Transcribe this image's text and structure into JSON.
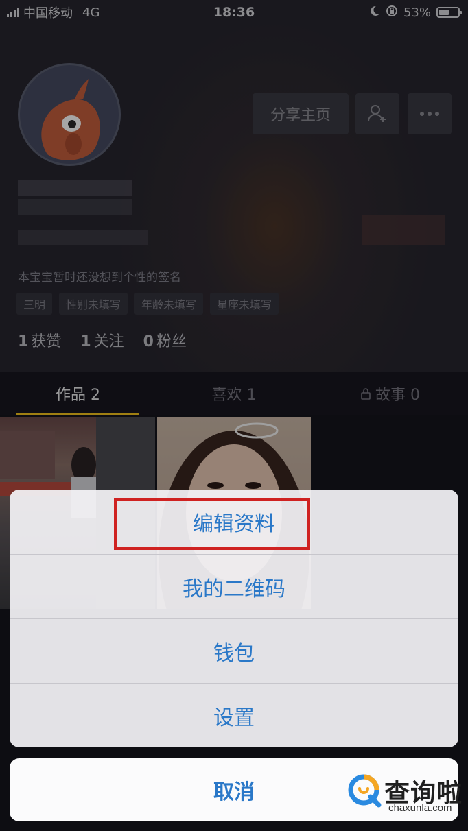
{
  "status_bar": {
    "carrier": "中国移动",
    "network": "4G",
    "time": "18:36",
    "battery": "53%",
    "battery_level": 0.53
  },
  "profile": {
    "share_label": "分享主页",
    "signature": "本宝宝暂时还没想到个性的签名",
    "tags": [
      "三明",
      "性别未填写",
      "年龄未填写",
      "星座未填写"
    ],
    "stats": [
      {
        "value": "1",
        "label": "获赞"
      },
      {
        "value": "1",
        "label": "关注"
      },
      {
        "value": "0",
        "label": "粉丝"
      }
    ]
  },
  "tabs": [
    {
      "label": "作品 2"
    },
    {
      "label": "喜欢 1"
    },
    {
      "label": "故事 0"
    }
  ],
  "action_sheet": {
    "items": [
      "编辑资料",
      "我的二维码",
      "钱包",
      "设置"
    ],
    "cancel": "取消"
  },
  "watermark": {
    "text": "查询啦",
    "sub": "chaxunla.com"
  },
  "colors": {
    "accent": "#2a78c8",
    "highlight": "#cf2221",
    "tab_indicator": "#f5c31d"
  }
}
